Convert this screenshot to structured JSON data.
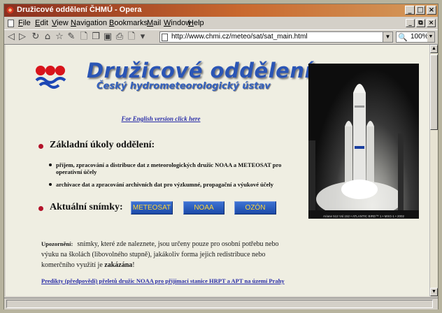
{
  "window": {
    "title": "Družicové oddělení ČHMÚ - Opera",
    "controls": {
      "minimize": "_",
      "maximize": "□",
      "close": "×"
    }
  },
  "menubar": {
    "items": [
      {
        "key": "F",
        "rest": "ile"
      },
      {
        "key": "E",
        "rest": "dit"
      },
      {
        "key": "V",
        "rest": "iew"
      },
      {
        "key": "N",
        "rest": "avigation"
      },
      {
        "key": "B",
        "rest": "ookmarks"
      },
      {
        "key": "M",
        "rest": "ail"
      },
      {
        "key": "W",
        "rest": "indow"
      },
      {
        "key": "H",
        "rest": "elp"
      }
    ],
    "mdi": {
      "minimize": "_",
      "restore": "⧉",
      "close": "×"
    }
  },
  "toolbar": {
    "address_url": "http://www.chmi.cz/meteo/sat/sat_main.html",
    "zoom": "100%"
  },
  "page": {
    "heading1": "Družicové oddělení",
    "heading2": "Český hydrometeorologický ústav",
    "english_link": "For English version click here",
    "tasks_title": "Základní úkoly oddělení:",
    "tasks": [
      "příjem, zpracování a distribuce dat z meteorologických družic NOAA a METEOSAT pro operativní účely",
      "archivace dat a zpracování archivních dat pro výzkumné, propagační a výukové účely"
    ],
    "snapshots_title": "Aktuální snímky:",
    "buttons": {
      "meteosat": "METEOSAT",
      "noaa": "NOAA",
      "ozon": "OZÓN"
    },
    "image_caption": "Ariane 512 Vol.152 • ATLANTIC BIRD™ 1 • MSG-1 • 2002",
    "warning_label": "Upozornění:",
    "warning_text_1": "snímky, které zde naleznete, jsou určeny pouze pro osobní potřebu nebo výuku na školách (libovolného stupně), jakákoliv forma jejich redistribuce nebo komerčního využití je",
    "warning_bold": "zakázána",
    "warning_end": "!",
    "predikty_link": "Predikty (předpovědi) přeletů družic NOAA pro přijímací stanice HRPT a APT na území Prahy"
  },
  "colors": {
    "title_accent": "#2a55b5",
    "bullet": "#b3122a",
    "button_text": "#ffd63a",
    "link": "#2a2ea8"
  }
}
